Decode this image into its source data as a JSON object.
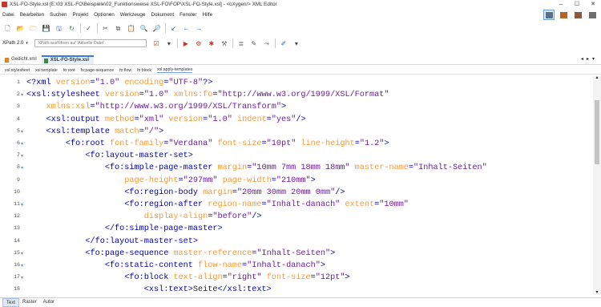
{
  "window": {
    "title": "XSL-FO-Style.xsl [E:\\03 XSL-FO\\Beispiele\\02_Funktionsweise XSL-FO\\FOP\\XSL-FO-Style.xsl] - <oXygen/> XML Editor",
    "minimize": "–",
    "maximize": "☐",
    "close": "✕"
  },
  "menu": {
    "items": [
      "Datei",
      "Bearbeiten",
      "Suchen",
      "Projekt",
      "Optionen",
      "Werkzeuge",
      "Dokument",
      "Fenster",
      "Hilfe"
    ]
  },
  "xpath": {
    "label": "XPath 2.0",
    "combo_arrow": "▾",
    "placeholder": "XPath ausführen auf 'Aktuelle Datei'"
  },
  "tabs": [
    {
      "label": "Gedicht.xml"
    },
    {
      "label": "XSL-FO-Style.xsl",
      "active": true
    }
  ],
  "tab_nav": "◂▸▾",
  "breadcrumb": [
    "xsl:stylesheet",
    "xsl:template",
    "fo:root",
    "fo:page-sequence",
    "fo:flow",
    "fo:block",
    "xsl:apply-templates"
  ],
  "code": {
    "line_numbers": [
      "1",
      "2",
      "3",
      "4",
      "5",
      "6",
      "7",
      "8",
      "9",
      "10",
      "11",
      "12",
      "13",
      "14",
      "15",
      "16",
      "17",
      "18"
    ],
    "fold_marks": [
      "",
      "▾",
      "",
      "",
      "▾",
      "▾",
      "▾",
      "▾",
      "",
      "",
      "▾",
      "",
      "",
      "",
      "▾",
      "▾",
      "▾",
      ""
    ],
    "lines": [
      [
        {
          "c": "decl",
          "t": "<?xml "
        },
        {
          "c": "attr",
          "t": "version"
        },
        {
          "c": "decl",
          "t": "="
        },
        {
          "c": "val",
          "t": "\"1.0\""
        },
        {
          "c": "decl",
          "t": " "
        },
        {
          "c": "attr",
          "t": "encoding"
        },
        {
          "c": "decl",
          "t": "="
        },
        {
          "c": "val",
          "t": "\"UTF-8\""
        },
        {
          "c": "decl",
          "t": "?>"
        }
      ],
      [
        {
          "c": "tag",
          "t": "<xsl:stylesheet "
        },
        {
          "c": "attr",
          "t": "version"
        },
        {
          "c": "tag",
          "t": "="
        },
        {
          "c": "val",
          "t": "\"1.0\""
        },
        {
          "c": "tag",
          "t": " "
        },
        {
          "c": "attr",
          "t": "xmlns:fo"
        },
        {
          "c": "tag",
          "t": "="
        },
        {
          "c": "val",
          "t": "\"http://www.w3.org/1999/XSL/Format\""
        }
      ],
      [
        {
          "c": "text",
          "t": "    "
        },
        {
          "c": "attr",
          "t": "xmlns:xsl"
        },
        {
          "c": "tag",
          "t": "="
        },
        {
          "c": "val",
          "t": "\"http://www.w3.org/1999/XSL/Transform\""
        },
        {
          "c": "tag",
          "t": ">"
        }
      ],
      [
        {
          "c": "text",
          "t": "    "
        },
        {
          "c": "tag",
          "t": "<xsl:output "
        },
        {
          "c": "attr",
          "t": "method"
        },
        {
          "c": "tag",
          "t": "="
        },
        {
          "c": "val",
          "t": "\"xml\""
        },
        {
          "c": "tag",
          "t": " "
        },
        {
          "c": "attr",
          "t": "version"
        },
        {
          "c": "tag",
          "t": "="
        },
        {
          "c": "val",
          "t": "\"1.0\""
        },
        {
          "c": "tag",
          "t": " "
        },
        {
          "c": "attr",
          "t": "indent"
        },
        {
          "c": "tag",
          "t": "="
        },
        {
          "c": "val",
          "t": "\"yes\""
        },
        {
          "c": "tag",
          "t": "/>"
        }
      ],
      [
        {
          "c": "text",
          "t": "    "
        },
        {
          "c": "tag",
          "t": "<xsl:template "
        },
        {
          "c": "attr",
          "t": "match"
        },
        {
          "c": "tag",
          "t": "="
        },
        {
          "c": "val",
          "t": "\"/\""
        },
        {
          "c": "tag",
          "t": ">"
        }
      ],
      [
        {
          "c": "text",
          "t": "        "
        },
        {
          "c": "tag",
          "t": "<fo:root "
        },
        {
          "c": "attr",
          "t": "font-family"
        },
        {
          "c": "tag",
          "t": "="
        },
        {
          "c": "val",
          "t": "\"Verdana\""
        },
        {
          "c": "tag",
          "t": " "
        },
        {
          "c": "attr",
          "t": "font-size"
        },
        {
          "c": "tag",
          "t": "="
        },
        {
          "c": "val",
          "t": "\"10pt\""
        },
        {
          "c": "tag",
          "t": " "
        },
        {
          "c": "attr",
          "t": "line-height"
        },
        {
          "c": "tag",
          "t": "="
        },
        {
          "c": "val",
          "t": "\"1.2\""
        },
        {
          "c": "tag",
          "t": ">"
        }
      ],
      [
        {
          "c": "text",
          "t": "            "
        },
        {
          "c": "tag",
          "t": "<fo:layout-master-set>"
        }
      ],
      [
        {
          "c": "text",
          "t": "                "
        },
        {
          "c": "tag",
          "t": "<fo:simple-page-master "
        },
        {
          "c": "attr",
          "t": "margin"
        },
        {
          "c": "tag",
          "t": "="
        },
        {
          "c": "val",
          "t": "\"10mm 7mm 18mm 18mm\""
        },
        {
          "c": "tag",
          "t": " "
        },
        {
          "c": "attr",
          "t": "master-name"
        },
        {
          "c": "tag",
          "t": "="
        },
        {
          "c": "val",
          "t": "\"Inhalt-Seiten\""
        }
      ],
      [
        {
          "c": "text",
          "t": "                    "
        },
        {
          "c": "attr",
          "t": "page-height"
        },
        {
          "c": "tag",
          "t": "="
        },
        {
          "c": "val",
          "t": "\"297mm\""
        },
        {
          "c": "tag",
          "t": " "
        },
        {
          "c": "attr",
          "t": "page-width"
        },
        {
          "c": "tag",
          "t": "="
        },
        {
          "c": "val",
          "t": "\"210mm\""
        },
        {
          "c": "tag",
          "t": ">"
        }
      ],
      [
        {
          "c": "text",
          "t": "                    "
        },
        {
          "c": "tag",
          "t": "<fo:region-body "
        },
        {
          "c": "attr",
          "t": "margin"
        },
        {
          "c": "tag",
          "t": "="
        },
        {
          "c": "val",
          "t": "\"20mm 30mm 20mm 0mm\""
        },
        {
          "c": "tag",
          "t": "/>"
        }
      ],
      [
        {
          "c": "text",
          "t": "                    "
        },
        {
          "c": "tag",
          "t": "<fo:region-after "
        },
        {
          "c": "attr",
          "t": "region-name"
        },
        {
          "c": "tag",
          "t": "="
        },
        {
          "c": "val",
          "t": "\"Inhalt-danach\""
        },
        {
          "c": "tag",
          "t": " "
        },
        {
          "c": "attr",
          "t": "extent"
        },
        {
          "c": "tag",
          "t": "="
        },
        {
          "c": "val",
          "t": "\"10mm\""
        }
      ],
      [
        {
          "c": "text",
          "t": "                        "
        },
        {
          "c": "attr",
          "t": "display-align"
        },
        {
          "c": "tag",
          "t": "="
        },
        {
          "c": "val",
          "t": "\"before\""
        },
        {
          "c": "tag",
          "t": "/>"
        }
      ],
      [
        {
          "c": "text",
          "t": "                "
        },
        {
          "c": "tag",
          "t": "</fo:simple-page-master>"
        }
      ],
      [
        {
          "c": "text",
          "t": "            "
        },
        {
          "c": "tag",
          "t": "</fo:layout-master-set>"
        }
      ],
      [
        {
          "c": "text",
          "t": "            "
        },
        {
          "c": "tag",
          "t": "<fo:page-sequence "
        },
        {
          "c": "attr",
          "t": "master-reference"
        },
        {
          "c": "tag",
          "t": "="
        },
        {
          "c": "val",
          "t": "\"Inhalt-Seiten\""
        },
        {
          "c": "tag",
          "t": ">"
        }
      ],
      [
        {
          "c": "text",
          "t": "                "
        },
        {
          "c": "tag",
          "t": "<fo:static-content "
        },
        {
          "c": "attr",
          "t": "flow-name"
        },
        {
          "c": "tag",
          "t": "="
        },
        {
          "c": "val",
          "t": "\"Inhalt-danach\""
        },
        {
          "c": "tag",
          "t": ">"
        }
      ],
      [
        {
          "c": "text",
          "t": "                    "
        },
        {
          "c": "tag",
          "t": "<fo:block "
        },
        {
          "c": "attr",
          "t": "text-align"
        },
        {
          "c": "tag",
          "t": "="
        },
        {
          "c": "val",
          "t": "\"right\""
        },
        {
          "c": "tag",
          "t": " "
        },
        {
          "c": "attr",
          "t": "font-size"
        },
        {
          "c": "tag",
          "t": "="
        },
        {
          "c": "val",
          "t": "\"12pt\""
        },
        {
          "c": "tag",
          "t": ">"
        }
      ],
      [
        {
          "c": "text",
          "t": "                        "
        },
        {
          "c": "tag",
          "t": "<xsl:text>"
        },
        {
          "c": "text",
          "t": "Seite"
        },
        {
          "c": "tag",
          "t": "</xsl:text>"
        }
      ]
    ]
  },
  "bottom_tabs": [
    {
      "label": "Text",
      "active": true
    },
    {
      "label": "Raster"
    },
    {
      "label": "Autor"
    }
  ],
  "colors": {
    "tag": "#0000aa",
    "attribute": "#f59a3a",
    "value": "#6a1b9a",
    "active_tab_accent": "#3c7fd1"
  },
  "icons": {
    "toolbar1": [
      {
        "name": "new-file-icon",
        "glyph": "🗋",
        "color": "#555"
      },
      {
        "name": "open-folder-icon",
        "glyph": "📂",
        "color": "#d9a028"
      },
      {
        "name": "open-url-icon",
        "glyph": "🗁",
        "color": "#d9a028"
      },
      {
        "name": "save-icon",
        "glyph": "💾",
        "color": "#3b62a6"
      },
      {
        "name": "save-all-icon",
        "glyph": "🖫",
        "color": "#3b62a6"
      },
      {
        "name": "reload-icon",
        "glyph": "↻",
        "color": "#2e8b3e"
      },
      {
        "sep": true
      },
      {
        "name": "spellcheck-icon",
        "glyph": "✓",
        "color": "#444"
      },
      {
        "sep": true
      },
      {
        "name": "cut-icon",
        "glyph": "✂",
        "color": "#555"
      },
      {
        "name": "copy-icon",
        "glyph": "⧉",
        "color": "#555"
      },
      {
        "name": "paste-icon",
        "glyph": "📋",
        "color": "#b07a2e"
      },
      {
        "name": "find-icon",
        "glyph": "🔍",
        "color": "#555"
      },
      {
        "name": "find-files-icon",
        "glyph": "🔎",
        "color": "#555"
      },
      {
        "sep": true
      },
      {
        "name": "back-to-last-edit-icon",
        "glyph": "↙",
        "color": "#2b5fb5"
      },
      {
        "name": "back-icon",
        "glyph": "←",
        "color": "#2b5fb5"
      },
      {
        "name": "forward-icon",
        "glyph": "→",
        "color": "#2b5fb5"
      }
    ],
    "toolbar2": [
      {
        "name": "validate-icon",
        "glyph": "☑",
        "color": "#c0392b"
      },
      {
        "name": "validate-dropdown-icon",
        "glyph": "▾",
        "color": "#444"
      },
      {
        "sep": true
      },
      {
        "name": "run-transformation-icon",
        "glyph": "▶",
        "color": "#c0392b"
      },
      {
        "name": "configure-transformation-icon",
        "glyph": "⚙",
        "color": "#c0392b"
      },
      {
        "name": "debug-icon",
        "glyph": "✱",
        "color": "#c0392b"
      },
      {
        "name": "xslt-tools-icon",
        "glyph": "⚒",
        "color": "#666"
      },
      {
        "sep": true
      },
      {
        "name": "format-indent-icon",
        "glyph": "≣",
        "color": "#555"
      },
      {
        "name": "toggle-comment-icon",
        "glyph": "✎",
        "color": "#555"
      },
      {
        "name": "refactoring-icon",
        "glyph": "⤳",
        "color": "#555"
      },
      {
        "sep": true
      },
      {
        "name": "edit-attributes-icon",
        "glyph": "✐",
        "color": "#2b5fb5"
      },
      {
        "name": "more-options-icon",
        "glyph": "▾",
        "color": "#444"
      }
    ],
    "perspectives": [
      {
        "name": "editor-perspective-icon",
        "variant": ""
      },
      {
        "name": "xslt-debugger-perspective-icon",
        "variant": "b"
      },
      {
        "name": "xquery-debugger-perspective-icon",
        "variant": "c"
      },
      {
        "name": "database-perspective-icon",
        "variant": "d"
      }
    ]
  }
}
